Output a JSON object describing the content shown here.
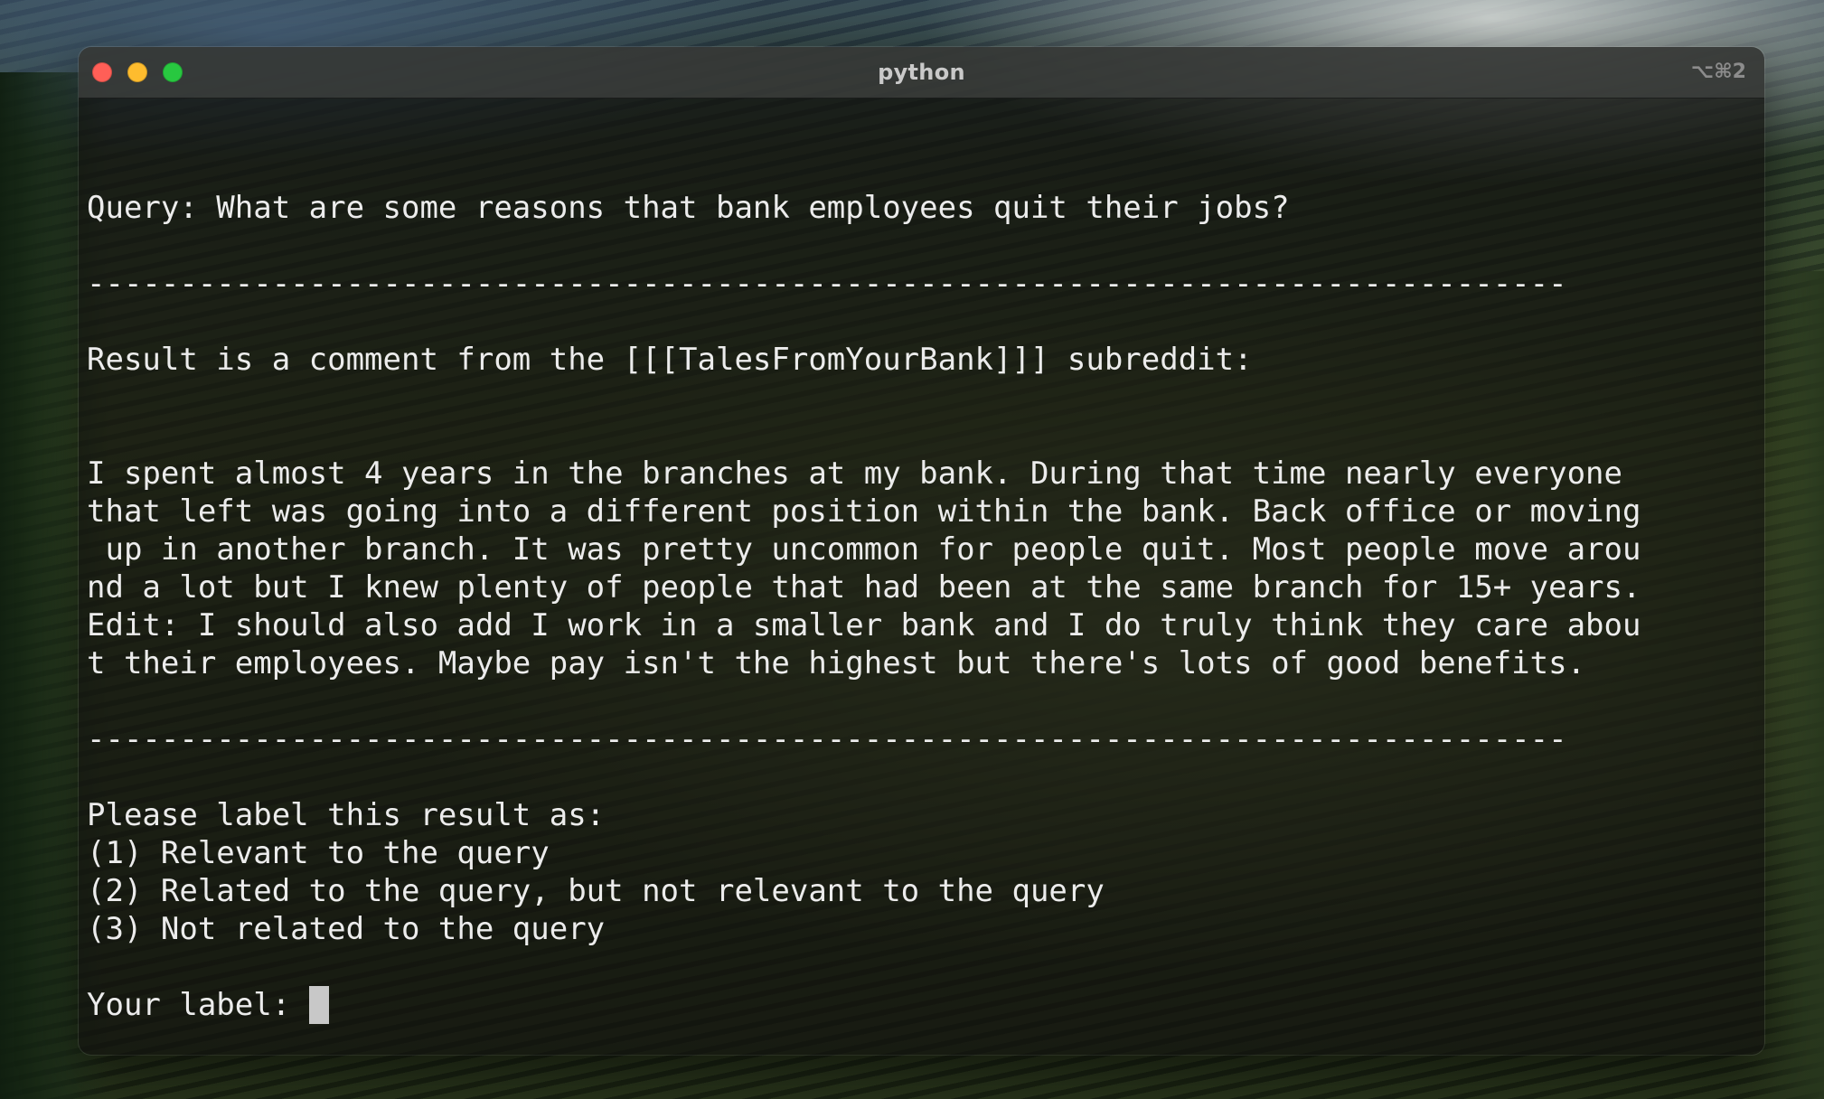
{
  "window": {
    "title": "python",
    "shortcut": "⌥⌘2",
    "colors": {
      "close": "#ff5f57",
      "minimize": "#febc2e",
      "zoom": "#28c840"
    }
  },
  "terminal": {
    "query_line": "Query: What are some reasons that bank employees quit their jobs?",
    "separator_1": "--------------------------------------------------------------------------------",
    "result_header": "Result is a comment from the [[[TalesFromYourBank]]] subreddit:",
    "comment_lines": [
      "I spent almost 4 years in the branches at my bank. During that time nearly everyone",
      "that left was going into a different position within the bank. Back office or moving",
      " up in another branch. It was pretty uncommon for people quit. Most people move arou",
      "nd a lot but I knew plenty of people that had been at the same branch for 15+ years.",
      "Edit: I should also add I work in a smaller bank and I do truly think they care abou",
      "t their employees. Maybe pay isn't the highest but there's lots of good benefits."
    ],
    "separator_2": "--------------------------------------------------------------------------------",
    "prompt_header": "Please label this result as:",
    "options": [
      "(1) Relevant to the query",
      "(2) Related to the query, but not relevant to the query",
      "(3) Not related to the query"
    ],
    "input_prompt": "Your label: "
  }
}
